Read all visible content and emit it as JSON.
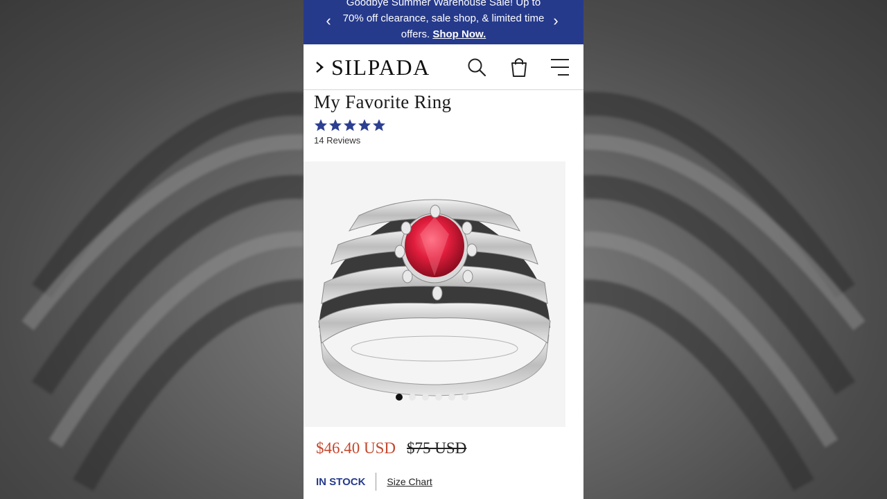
{
  "promo": {
    "line1": "Goodbye Summer Warehouse Sale! Up to",
    "line2": "70% off clearance, sale shop, & limited time",
    "line3": "offers.",
    "link": "Shop Now.",
    "prev_icon": "chevron-left-icon",
    "next_icon": "chevron-right-icon"
  },
  "header": {
    "logo": "SILPADA",
    "icons": [
      "search-icon",
      "shopping-bag-icon",
      "menu-icon"
    ]
  },
  "product": {
    "title": "My Favorite Ring",
    "rating": 5,
    "reviews": "14 Reviews",
    "sale_price": "$46.40 USD",
    "original_price": "$75 USD",
    "stock_status": "IN STOCK",
    "size_chart": "Size Chart"
  },
  "gallery": {
    "image_count": 6,
    "active_index": 0
  },
  "colors": {
    "brand_blue": "#263a8c",
    "sale_red": "#c4472c",
    "star_blue": "#2c3f91"
  }
}
